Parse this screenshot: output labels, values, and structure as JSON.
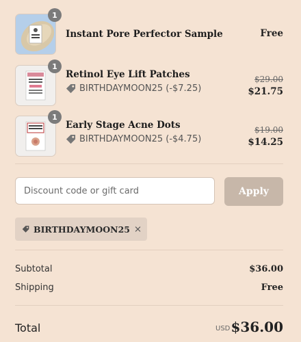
{
  "items": [
    {
      "name": "Instant Pore Perfector Sample",
      "qty": "1",
      "price": "Free"
    },
    {
      "name": "Retinol Eye Lift Patches",
      "qty": "1",
      "discount": "BIRTHDAYMOON25 (-$7.25)",
      "original_price": "$29.00",
      "price": "$21.75"
    },
    {
      "name": "Early Stage Acne Dots",
      "qty": "1",
      "discount": "BIRTHDAYMOON25 (-$4.75)",
      "original_price": "$19.00",
      "price": "$14.25"
    }
  ],
  "discount": {
    "placeholder": "Discount code or gift card",
    "apply_label": "Apply",
    "applied_code": "BIRTHDAYMOON25"
  },
  "summary": {
    "subtotal_label": "Subtotal",
    "subtotal_value": "$36.00",
    "shipping_label": "Shipping",
    "shipping_value": "Free",
    "total_label": "Total",
    "currency": "USD",
    "total_value": "$36.00"
  },
  "colors": {
    "background": "#f5e3d3",
    "apply_button": "#c7b7a9",
    "chip": "#e2d2c5"
  },
  "icons": [
    "tag-icon",
    "close-icon"
  ]
}
